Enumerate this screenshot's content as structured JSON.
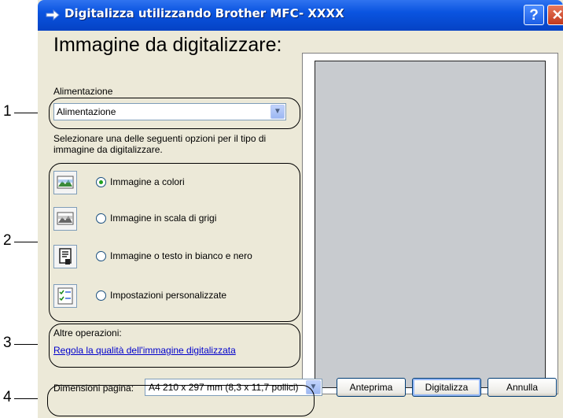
{
  "window": {
    "title": "Digitalizza utilizzando Brother MFC- XXXX",
    "help_glyph": "?",
    "close_glyph": "✕"
  },
  "main": {
    "heading": "Immagine da digitalizzare:",
    "source_label": "Alimentazione",
    "source_value": "Alimentazione",
    "description": "Selezionare una delle seguenti opzioni per il tipo di immagine da digitalizzare.",
    "options": [
      {
        "label": "Immagine a colori",
        "selected": true,
        "icon": "color-image-icon"
      },
      {
        "label": "Immagine in scala di grigi",
        "selected": false,
        "icon": "grayscale-image-icon"
      },
      {
        "label": "Immagine o testo in bianco e nero",
        "selected": false,
        "icon": "black-white-text-icon"
      },
      {
        "label": "Impostazioni personalizzate",
        "selected": false,
        "icon": "custom-settings-icon"
      }
    ],
    "other_label": "Altre operazioni:",
    "quality_link": "Regola la qualità dell'immagine digitalizzata",
    "page_size_label": "Dimensioni pagina:",
    "page_size_value": "A4 210 x 297 mm (8,3 x 11,7 pollici)"
  },
  "buttons": {
    "preview": "Anteprima",
    "scan": "Digitalizza",
    "cancel": "Annulla"
  },
  "callouts": [
    "1",
    "2",
    "3",
    "4"
  ],
  "colors": {
    "titlebar": "#0a54e0",
    "dialog_bg": "#ece9d8",
    "preview_page": "#c8cbcf",
    "link": "#0000cc"
  }
}
